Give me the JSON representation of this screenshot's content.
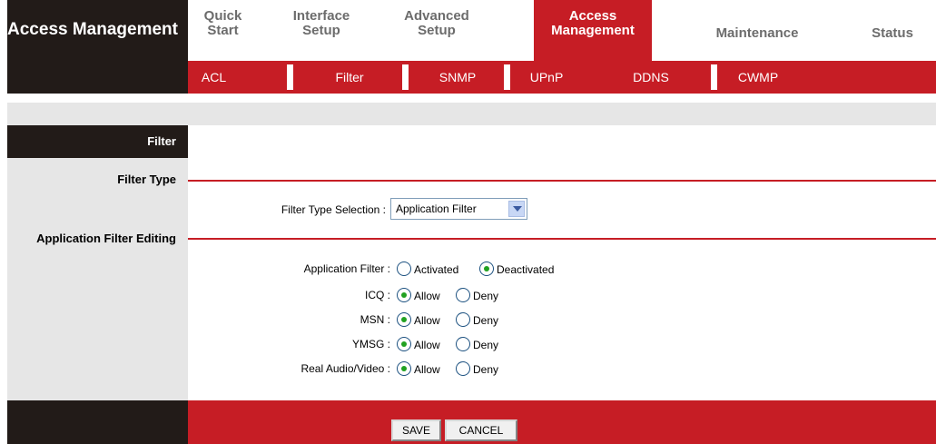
{
  "brand": {
    "title": "Access Management"
  },
  "nav": {
    "top_tabs": [
      "Quick Start",
      "Interface Setup",
      "Advanced Setup",
      "Access Management",
      "Maintenance",
      "Status"
    ],
    "active_top": "Access Management",
    "sub_tabs": [
      "ACL",
      "Filter",
      "SNMP",
      "UPnP",
      "DDNS",
      "CWMP"
    ],
    "active_sub": "Filter"
  },
  "sections": {
    "filter": "Filter",
    "filter_type": "Filter Type",
    "app_editing": "Application Filter Editing"
  },
  "filter_type": {
    "label": "Filter Type Selection :",
    "selected": "Application Filter"
  },
  "app_filter": {
    "label": "Application Filter :",
    "options": [
      "Activated",
      "Deactivated"
    ],
    "selected": "Deactivated"
  },
  "apps": [
    {
      "label": "ICQ :",
      "allow": "Allow",
      "deny": "Deny",
      "selected": "Allow"
    },
    {
      "label": "MSN :",
      "allow": "Allow",
      "deny": "Deny",
      "selected": "Allow"
    },
    {
      "label": "YMSG :",
      "allow": "Allow",
      "deny": "Deny",
      "selected": "Allow"
    },
    {
      "label": "Real Audio/Video :",
      "allow": "Allow",
      "deny": "Deny",
      "selected": "Allow"
    }
  ],
  "buttons": {
    "save": "SAVE",
    "cancel": "CANCEL"
  },
  "colors": {
    "accent_red": "#c61d25",
    "dark": "#221b18",
    "panel_grey": "#e6e6e6"
  }
}
